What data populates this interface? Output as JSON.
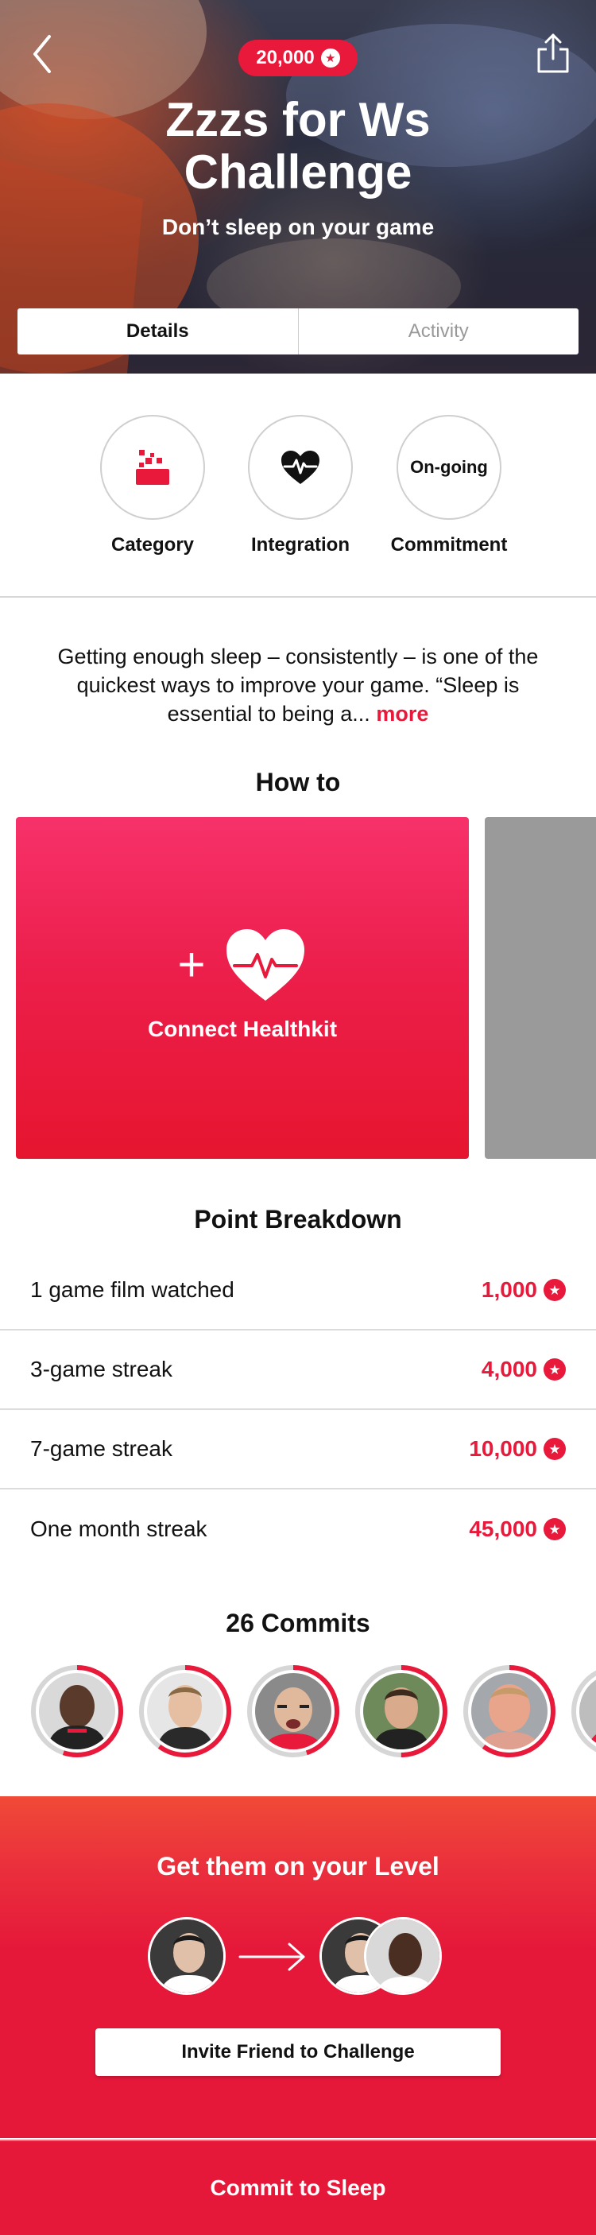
{
  "header": {
    "points": "20,000",
    "title_line1": "Zzzs for Ws",
    "title_line2": "Challenge",
    "subtitle": "Don’t sleep on your game",
    "tabs": [
      {
        "label": "Details",
        "active": true
      },
      {
        "label": "Activity",
        "active": false
      }
    ]
  },
  "attributes": [
    {
      "label": "Category",
      "icon": "category-pixels-icon"
    },
    {
      "label": "Integration",
      "icon": "heart-pulse-icon"
    },
    {
      "label": "Commitment",
      "value": "On-going"
    }
  ],
  "description": {
    "text": "Getting enough sleep – consistently – is one of the quickest ways to improve your game. “Sleep is essential to being a...",
    "more_label": "more"
  },
  "how_to": {
    "title": "How to",
    "cards": [
      {
        "label": "Connect Healthkit",
        "icon": "add-heart-pulse-icon"
      }
    ]
  },
  "point_breakdown": {
    "title": "Point Breakdown",
    "rows": [
      {
        "label": "1 game film watched",
        "points": "1,000"
      },
      {
        "label": "3-game streak",
        "points": "4,000"
      },
      {
        "label": "7-game streak",
        "points": "10,000"
      },
      {
        "label": "One month streak",
        "points": "45,000"
      }
    ]
  },
  "commits": {
    "title": "26 Commits",
    "progress": [
      0.55,
      0.6,
      0.45,
      0.5,
      0.6,
      0.3
    ]
  },
  "invite": {
    "title": "Get them on your Level",
    "button_label": "Invite Friend to Challenge"
  },
  "footer": {
    "commit_label": "Commit to Sleep"
  },
  "colors": {
    "accent": "#e8193a",
    "divider": "#dcdcdc"
  }
}
